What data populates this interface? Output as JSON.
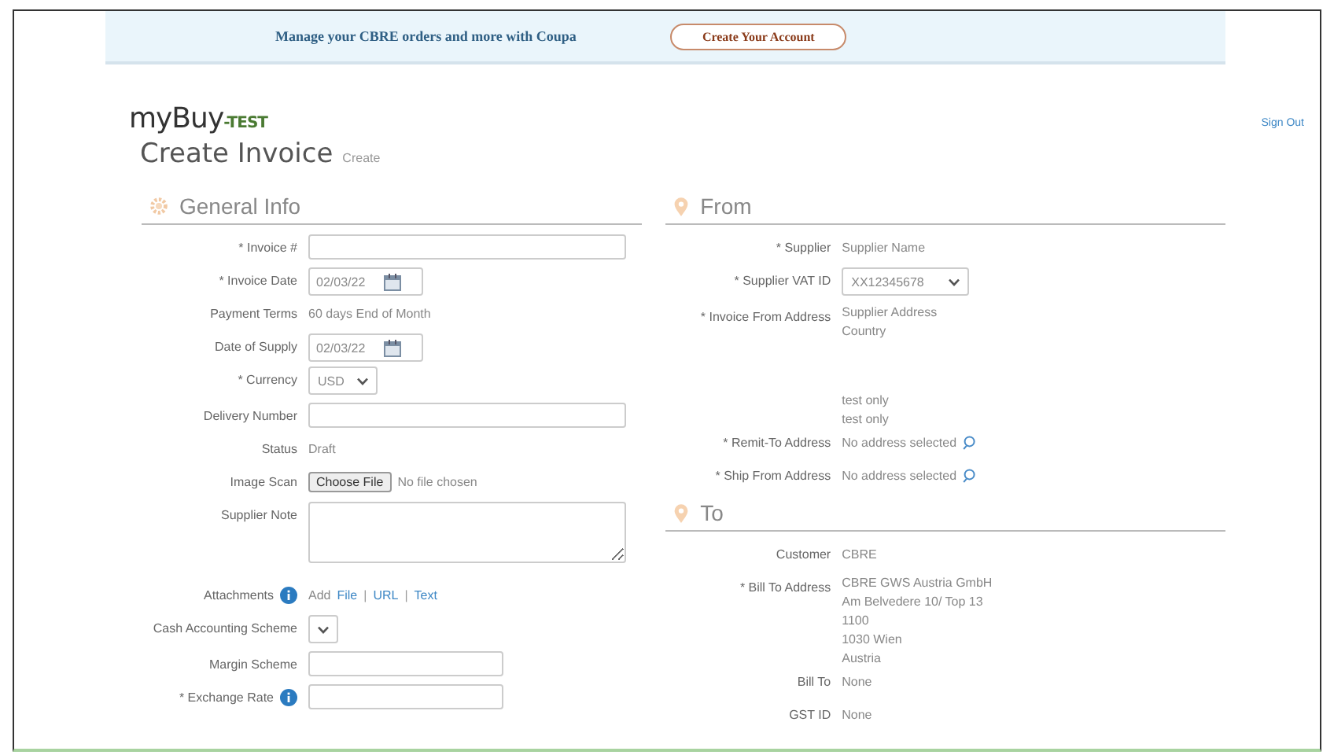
{
  "banner": {
    "message": "Manage your CBRE orders and more with Coupa",
    "button": "Create Your Account"
  },
  "header": {
    "logo": "myBuy",
    "logo_suffix": "-TEST",
    "sign_out": "Sign Out",
    "title": "Create Invoice",
    "subtitle": "Create"
  },
  "columns": [
    {
      "sections": [
        {
          "title": "General Info",
          "rows": [
            {
              "kind": "input",
              "label": "* Invoice #"
            },
            {
              "kind": "date",
              "label": "* Invoice Date",
              "value": "02/03/22"
            },
            {
              "kind": "text",
              "label": "Payment Terms",
              "value": "60 days End of Month"
            },
            {
              "kind": "date",
              "label": "Date of Supply",
              "value": "02/03/22"
            },
            {
              "kind": "select",
              "label": "* Currency",
              "value": "USD"
            },
            {
              "kind": "input",
              "label": "Delivery Number"
            },
            {
              "kind": "text",
              "label": "Status",
              "value": "Draft"
            },
            {
              "kind": "file",
              "label": "Image Scan",
              "button": "Choose File",
              "value": "No file chosen"
            },
            {
              "kind": "textarea",
              "label": "Supplier Note"
            },
            {
              "kind": "attachments",
              "label": "Attachments",
              "info": true,
              "value": "Add",
              "links": [
                "File",
                "URL",
                "Text"
              ],
              "separator": "|"
            },
            {
              "kind": "select",
              "label": "Cash Accounting Scheme"
            },
            {
              "kind": "input_short",
              "label": "Margin Scheme"
            },
            {
              "kind": "input_short",
              "label": "* Exchange Rate",
              "info": true
            }
          ]
        }
      ]
    },
    {
      "sections": [
        {
          "title": "From",
          "rows": [
            {
              "kind": "text",
              "label": "* Supplier",
              "value": "Supplier Name"
            },
            {
              "kind": "select",
              "label": "* Supplier VAT ID",
              "value": "XX12345678"
            },
            {
              "kind": "lines",
              "label": "* Invoice From Address",
              "lines": [
                "Supplier Address",
                "Country"
              ]
            },
            {
              "kind": "lines",
              "lines": [
                "test only",
                "test only"
              ]
            },
            {
              "kind": "lookup",
              "label": "* Remit-To Address",
              "value": "No address selected"
            },
            {
              "kind": "lookup",
              "label": "* Ship From Address",
              "value": "No address selected"
            }
          ]
        },
        {
          "title": "To",
          "rows": [
            {
              "kind": "text",
              "label": "Customer",
              "value": "CBRE"
            },
            {
              "kind": "lines",
              "label": "* Bill To Address",
              "lines": [
                "CBRE GWS Austria GmbH",
                "Am Belvedere 10/ Top 13",
                "1100",
                "1030 Wien",
                "Austria"
              ]
            },
            {
              "kind": "text",
              "label": "Bill To",
              "value": "None"
            },
            {
              "kind": "text",
              "label": "GST ID",
              "value": "None"
            }
          ]
        }
      ]
    }
  ]
}
